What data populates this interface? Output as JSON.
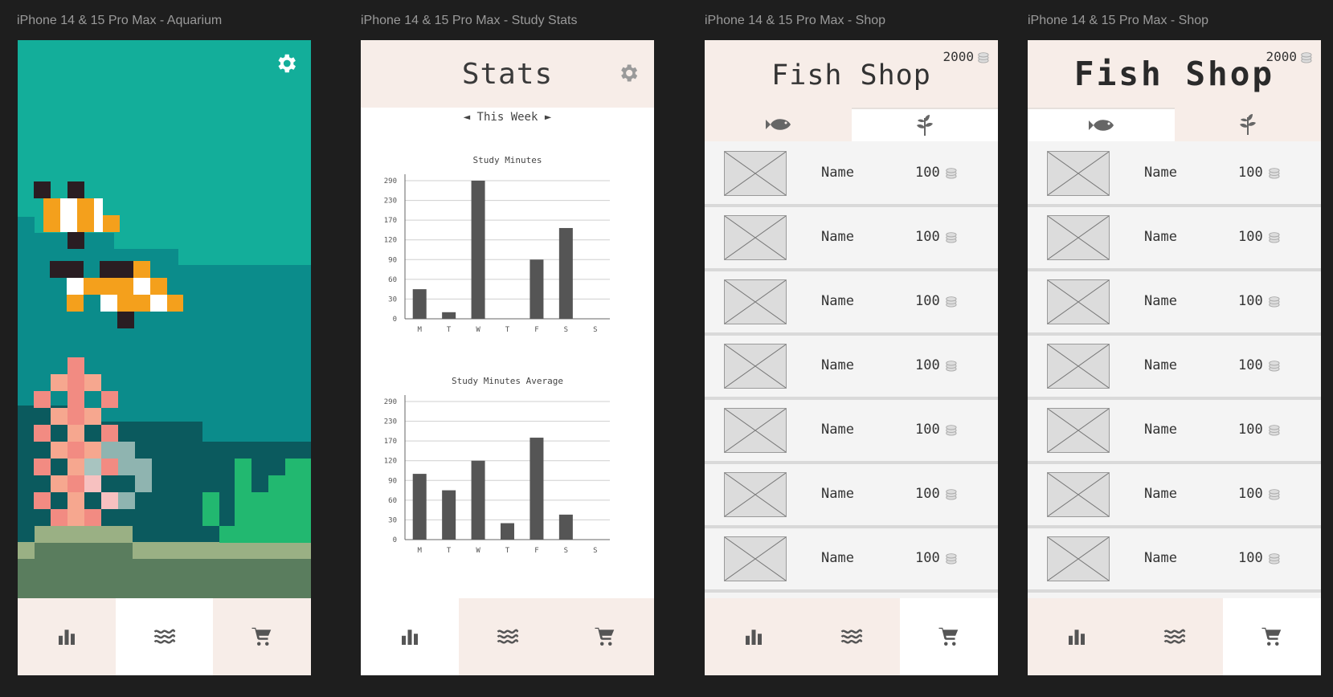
{
  "frames": {
    "aquarium": {
      "title": "iPhone 14 & 15 Pro Max - Aquarium"
    },
    "stats": {
      "title": "iPhone 14 & 15 Pro Max - Study Stats",
      "header": "Stats",
      "week_label": "◄ This Week ►"
    },
    "shop1": {
      "title": "iPhone 14 & 15 Pro Max - Shop",
      "header": "Fish Shop",
      "coins": "2000"
    },
    "shop2": {
      "title": "iPhone 14 & 15 Pro Max - Shop",
      "header": "Fish Shop",
      "coins": "2000"
    }
  },
  "shop_items": [
    {
      "name": "Name",
      "price": "100"
    },
    {
      "name": "Name",
      "price": "100"
    },
    {
      "name": "Name",
      "price": "100"
    },
    {
      "name": "Name",
      "price": "100"
    },
    {
      "name": "Name",
      "price": "100"
    },
    {
      "name": "Name",
      "price": "100"
    },
    {
      "name": "Name",
      "price": "100"
    }
  ],
  "icons": {
    "nav": [
      "bar-chart-icon",
      "waves-icon",
      "cart-icon"
    ],
    "tabs": [
      "fish-icon",
      "plant-icon"
    ],
    "settings": "gear-icon",
    "coin": "coin-stack-icon"
  },
  "colors": {
    "header_bg": "#f7ede8",
    "water_top": "#13ae9a",
    "water_mid": "#0b8c8b",
    "water_deep": "#0b5a5e",
    "bar": "#555555"
  },
  "chart_data": [
    {
      "type": "bar",
      "title": "Study Minutes",
      "categories": [
        "M",
        "T",
        "W",
        "T",
        "F",
        "S",
        "S"
      ],
      "values": [
        45,
        10,
        290,
        0,
        90,
        150,
        0
      ],
      "yticks": [
        0,
        30,
        60,
        90,
        120,
        170,
        230,
        290
      ],
      "grid": true
    },
    {
      "type": "bar",
      "title": "Study Minutes Average",
      "categories": [
        "M",
        "T",
        "W",
        "T",
        "F",
        "S",
        "S"
      ],
      "values": [
        100,
        75,
        120,
        25,
        180,
        38,
        0
      ],
      "yticks": [
        0,
        30,
        60,
        90,
        120,
        170,
        230,
        290
      ],
      "grid": true
    }
  ]
}
